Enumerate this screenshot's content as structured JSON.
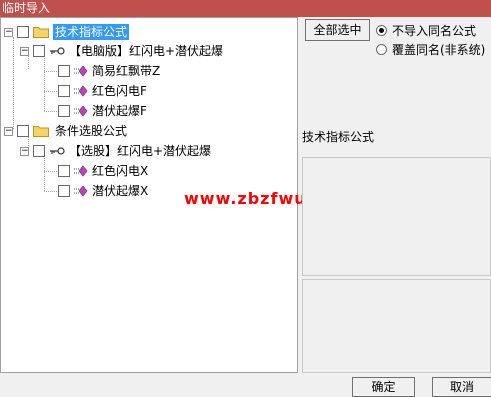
{
  "window": {
    "title": "临时导入"
  },
  "tree": {
    "nodes": [
      {
        "label": "技术指标公式",
        "selected": true,
        "icon": "folder-icon"
      },
      {
        "label": "【电脑版】红闪电+潜伏起爆",
        "icon": "key-icon"
      },
      {
        "label": "简易红飘带Z",
        "icon": "formula-item-icon"
      },
      {
        "label": "红色闪电F",
        "icon": "formula-item-icon"
      },
      {
        "label": "潜伏起爆F",
        "icon": "formula-item-icon"
      },
      {
        "label": "条件选股公式",
        "icon": "folder-icon"
      },
      {
        "label": "【选股】红闪电+潜伏起爆",
        "icon": "key-icon"
      },
      {
        "label": "红色闪电X",
        "icon": "formula-item-icon"
      },
      {
        "label": "潜伏起爆X",
        "icon": "formula-item-icon"
      }
    ]
  },
  "watermark": "www.zbzfwu.com",
  "right": {
    "select_all": "全部选中",
    "options": [
      {
        "label": "不导入同名公式",
        "checked": true
      },
      {
        "label": "覆盖同名(非系统)",
        "checked": false
      }
    ],
    "section_label": "技术指标公式"
  },
  "buttons": {
    "ok": "确定",
    "cancel": "取消"
  }
}
